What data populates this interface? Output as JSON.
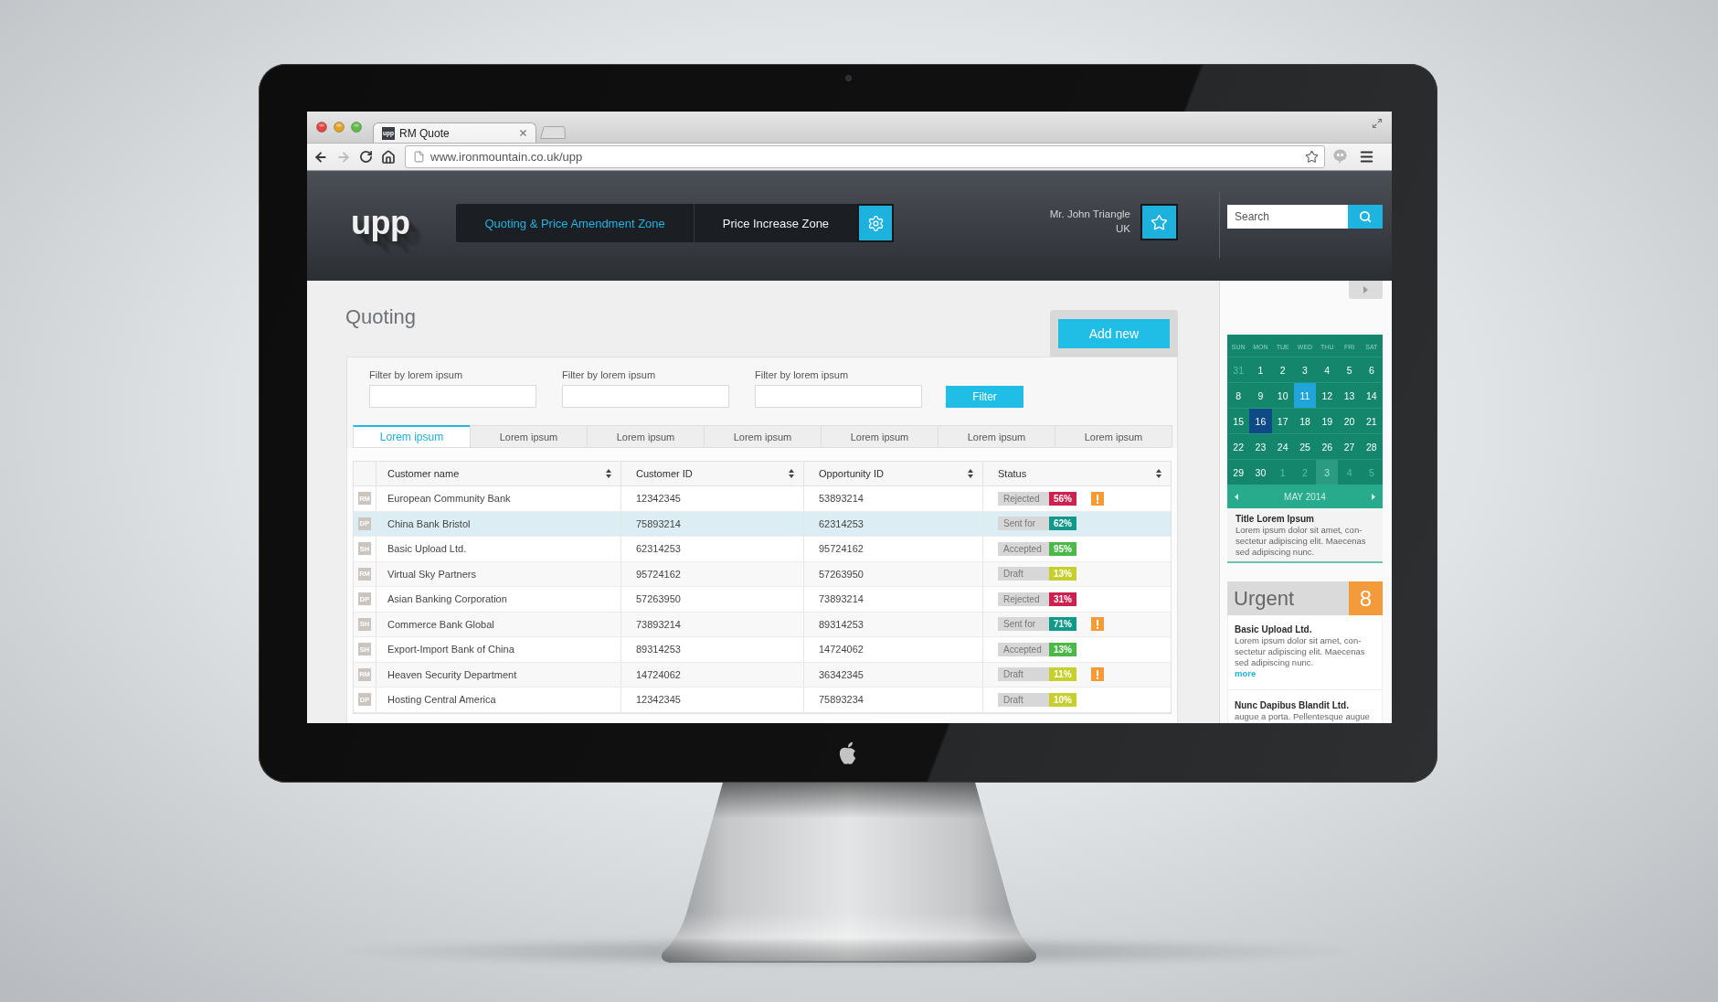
{
  "browser": {
    "tab": {
      "favicon": "upp",
      "title": "RM Quote"
    },
    "forward_disabled": true,
    "url": "www.ironmountain.co.uk/upp"
  },
  "header": {
    "logo": "upp",
    "nav": [
      {
        "label": "Quoting & Price Amendment Zone",
        "selected": true
      },
      {
        "label": "Price Increase Zone",
        "selected": false
      }
    ],
    "user": {
      "name": "Mr. John Triangle",
      "country": "UK"
    },
    "search": {
      "placeholder": "Search"
    }
  },
  "main": {
    "title": "Quoting",
    "add_button": "Add new",
    "filters": [
      {
        "label": "Filter by lorem ipsum"
      },
      {
        "label": "Filter by lorem ipsum"
      },
      {
        "label": "Filter by lorem ipsum"
      }
    ],
    "filter_button": "Filter",
    "tabs": [
      {
        "label": "Lorem ipsum",
        "selected": true
      },
      {
        "label": "Lorem ipsum",
        "selected": false
      },
      {
        "label": "Lorem ipsum",
        "selected": false
      },
      {
        "label": "Lorem ipsum",
        "selected": false
      },
      {
        "label": "Lorem ipsum",
        "selected": false
      },
      {
        "label": "Lorem ipsum",
        "selected": false
      },
      {
        "label": "Lorem ipsum",
        "selected": false
      }
    ],
    "table": {
      "columns": [
        "Customer name",
        "Customer ID",
        "Opportunity ID",
        "Status"
      ],
      "rows": [
        {
          "initials": "RM",
          "customer_name": "European Community Bank",
          "customer_id": "12342345",
          "opportunity_id": "53893214",
          "status": "Rejected",
          "percent": "56%",
          "color": "#cd2150",
          "flagged": true,
          "selected": false
        },
        {
          "initials": "DP",
          "customer_name": "China Bank Bristol",
          "customer_id": "75893214",
          "opportunity_id": "62314253",
          "status": "Sent for",
          "percent": "62%",
          "color": "#13998a",
          "flagged": false,
          "selected": true
        },
        {
          "initials": "SH",
          "customer_name": "Basic Upload Ltd.",
          "customer_id": "62314253",
          "opportunity_id": "95724162",
          "status": "Accepted",
          "percent": "95%",
          "color": "#4db84a",
          "flagged": false,
          "selected": false
        },
        {
          "initials": "RM",
          "customer_name": "Virtual Sky Partners",
          "customer_id": "95724162",
          "opportunity_id": "57263950",
          "status": "Draft",
          "percent": "13%",
          "color": "#c6cf2e",
          "flagged": false,
          "selected": false
        },
        {
          "initials": "DP",
          "customer_name": "Asian Banking Corporation",
          "customer_id": "57263950",
          "opportunity_id": "73893214",
          "status": "Rejected",
          "percent": "31%",
          "color": "#cd2150",
          "flagged": false,
          "selected": false
        },
        {
          "initials": "SH",
          "customer_name": "Commerce Bank Global",
          "customer_id": "73893214",
          "opportunity_id": "89314253",
          "status": "Sent for",
          "percent": "71%",
          "color": "#13998a",
          "flagged": true,
          "selected": false
        },
        {
          "initials": "SH",
          "customer_name": "Export-Import Bank of China",
          "customer_id": "89314253",
          "opportunity_id": "14724062",
          "status": "Accepted",
          "percent": "13%",
          "color": "#4db84a",
          "flagged": false,
          "selected": false
        },
        {
          "initials": "RM",
          "customer_name": "Heaven Security Department",
          "customer_id": "14724062",
          "opportunity_id": "36342345",
          "status": "Draft",
          "percent": "11%",
          "color": "#c6cf2e",
          "flagged": true,
          "selected": false
        },
        {
          "initials": "DP",
          "customer_name": "Hosting Central America",
          "customer_id": "12342345",
          "opportunity_id": "75893234",
          "status": "Draft",
          "percent": "10%",
          "color": "#c6cf2e",
          "flagged": false,
          "selected": false
        }
      ]
    }
  },
  "sidebar": {
    "calendar": {
      "weekdays": [
        "SUN",
        "MON",
        "TUE",
        "WED",
        "THU",
        "FRI",
        "SAT"
      ],
      "weeks": [
        [
          {
            "day": "31",
            "kind": "outside",
            "selected": false
          },
          {
            "day": "1",
            "kind": "inside",
            "selected": false
          },
          {
            "day": "2",
            "kind": "inside",
            "selected": false
          },
          {
            "day": "3",
            "kind": "inside",
            "selected": false
          },
          {
            "day": "4",
            "kind": "inside",
            "selected": false
          },
          {
            "day": "5",
            "kind": "inside",
            "selected": false
          },
          {
            "day": "6",
            "kind": "inside",
            "selected": false
          }
        ],
        [
          {
            "day": "8",
            "kind": "inside",
            "selected": false
          },
          {
            "day": "9",
            "kind": "inside",
            "selected": false
          },
          {
            "day": "10",
            "kind": "inside",
            "selected": false
          },
          {
            "day": "11",
            "kind": "today",
            "selected": false
          },
          {
            "day": "12",
            "kind": "inside",
            "selected": false
          },
          {
            "day": "13",
            "kind": "inside",
            "selected": false
          },
          {
            "day": "14",
            "kind": "inside",
            "selected": false
          }
        ],
        [
          {
            "day": "15",
            "kind": "inside",
            "selected": false
          },
          {
            "day": "16",
            "kind": "inside",
            "selected": true
          },
          {
            "day": "17",
            "kind": "inside",
            "selected": false
          },
          {
            "day": "18",
            "kind": "inside",
            "selected": false
          },
          {
            "day": "19",
            "kind": "inside",
            "selected": false
          },
          {
            "day": "20",
            "kind": "inside",
            "selected": false
          },
          {
            "day": "21",
            "kind": "inside",
            "selected": false
          }
        ],
        [
          {
            "day": "22",
            "kind": "inside",
            "selected": false
          },
          {
            "day": "23",
            "kind": "inside",
            "selected": false
          },
          {
            "day": "24",
            "kind": "inside",
            "selected": false
          },
          {
            "day": "25",
            "kind": "inside",
            "selected": false
          },
          {
            "day": "26",
            "kind": "inside",
            "selected": false
          },
          {
            "day": "27",
            "kind": "inside",
            "selected": false
          },
          {
            "day": "28",
            "kind": "inside",
            "selected": false
          }
        ],
        [
          {
            "day": "29",
            "kind": "inside",
            "selected": false
          },
          {
            "day": "30",
            "kind": "inside",
            "selected": false
          },
          {
            "day": "1",
            "kind": "outside",
            "selected": false
          },
          {
            "day": "2",
            "kind": "outside",
            "selected": false
          },
          {
            "day": "3",
            "kind": "shaded",
            "selected": false
          },
          {
            "day": "4",
            "kind": "outside",
            "selected": false
          },
          {
            "day": "5",
            "kind": "outside",
            "selected": false
          }
        ]
      ],
      "month": "MAY 2014"
    },
    "event": {
      "title": "Title Lorem Ipsum",
      "text": "Lorem ipsum dolor sit amet, con-sectetur adipiscing elit. Maecenas sed adipiscing nunc."
    },
    "urgent": {
      "title": "Urgent",
      "count": "8",
      "items": [
        {
          "title": "Basic Upload Ltd.",
          "text": "Lorem ipsum dolor sit amet, con-sectetur adipiscing elit. Maecenas sed adipiscing nunc.",
          "link": "more"
        },
        {
          "title": "Nunc Dapibus Blandit Ltd.",
          "text": "augue a porta. Pellentesque augue"
        }
      ]
    }
  }
}
